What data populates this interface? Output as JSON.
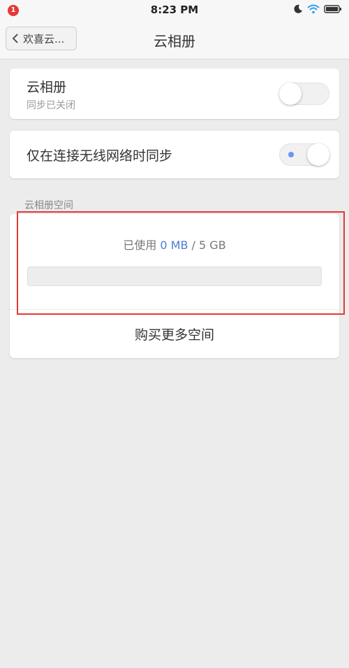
{
  "status_bar": {
    "notification_count": "1",
    "time": "8:23 PM",
    "icons": [
      "moon-icon",
      "wifi-icon",
      "battery-icon"
    ]
  },
  "nav": {
    "back_label": "欢喜云...",
    "title": "云相册"
  },
  "sync": {
    "title": "云相册",
    "subtitle": "同步已关闭",
    "enabled": false
  },
  "wifi_only": {
    "title": "仅在连接无线网络时同步",
    "enabled": true
  },
  "storage": {
    "section_header": "云相册空间",
    "used_prefix": "已使用 ",
    "used": "0 MB",
    "separator": " / ",
    "total": "5 GB",
    "used_fraction": 0,
    "buy_label": "购买更多空间"
  },
  "colors": {
    "accent": "#4b7bd6",
    "highlight": "#e53935"
  }
}
